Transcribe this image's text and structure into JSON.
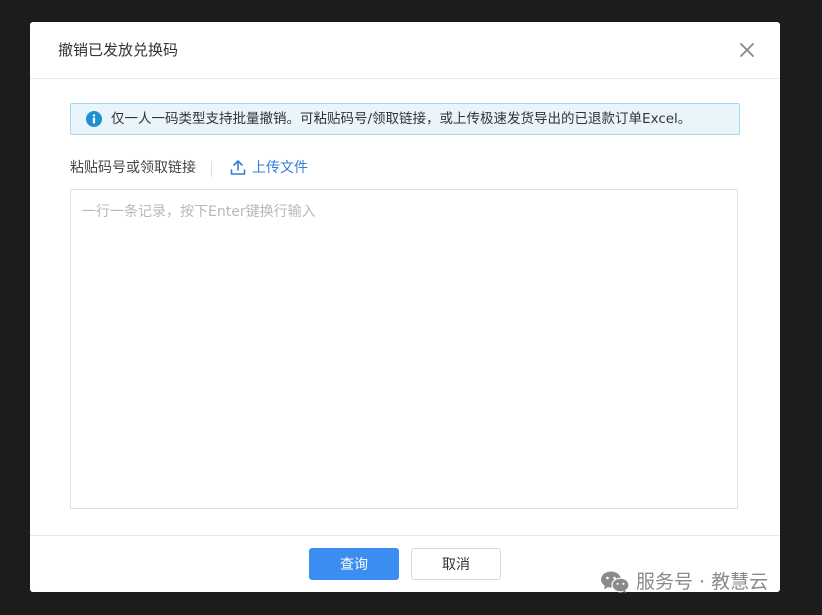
{
  "dialog": {
    "title": "撤销已发放兑换码"
  },
  "info_banner": {
    "text": "仅一人一码类型支持批量撤销。可粘贴码号/领取链接，或上传极速发货导出的已退款订单Excel。"
  },
  "paste_section": {
    "label": "粘贴码号或领取链接",
    "upload_label": "上传文件",
    "textarea_placeholder": "一行一条记录，按下Enter键换行输入",
    "textarea_value": ""
  },
  "footer": {
    "query_label": "查询",
    "cancel_label": "取消"
  },
  "watermark": {
    "text": "服务号 · 教慧云"
  },
  "colors": {
    "accent": "#3b8df2",
    "link": "#2f7fd8",
    "info_bg": "#e9f5fb",
    "info_border": "#a6d8ee",
    "info_icon": "#1f8fd0"
  }
}
